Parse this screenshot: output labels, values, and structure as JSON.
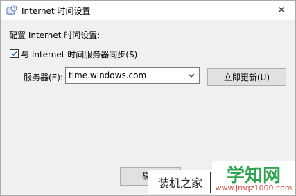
{
  "window": {
    "title": "Internet 时间设置",
    "close_glyph": "✕",
    "app_icon": "internet-time-icon"
  },
  "content": {
    "heading": "配置 Internet 时间设置:",
    "sync_checkbox": {
      "label": "与 Internet 时间服务器同步(S)",
      "checked": true
    },
    "server_label": "服务器(E):",
    "server_value": "time.windows.com",
    "update_button": "立即更新(U)"
  },
  "footer": {
    "ok_button": "确定"
  },
  "watermark": {
    "left_text": "装机之家",
    "brand_text": "学知网",
    "url_text": "www.jmqz1000.com"
  },
  "colors": {
    "checkbox_check": "#2b5797",
    "brand_green": "#2ea44f",
    "url_red": "#d9534f"
  }
}
